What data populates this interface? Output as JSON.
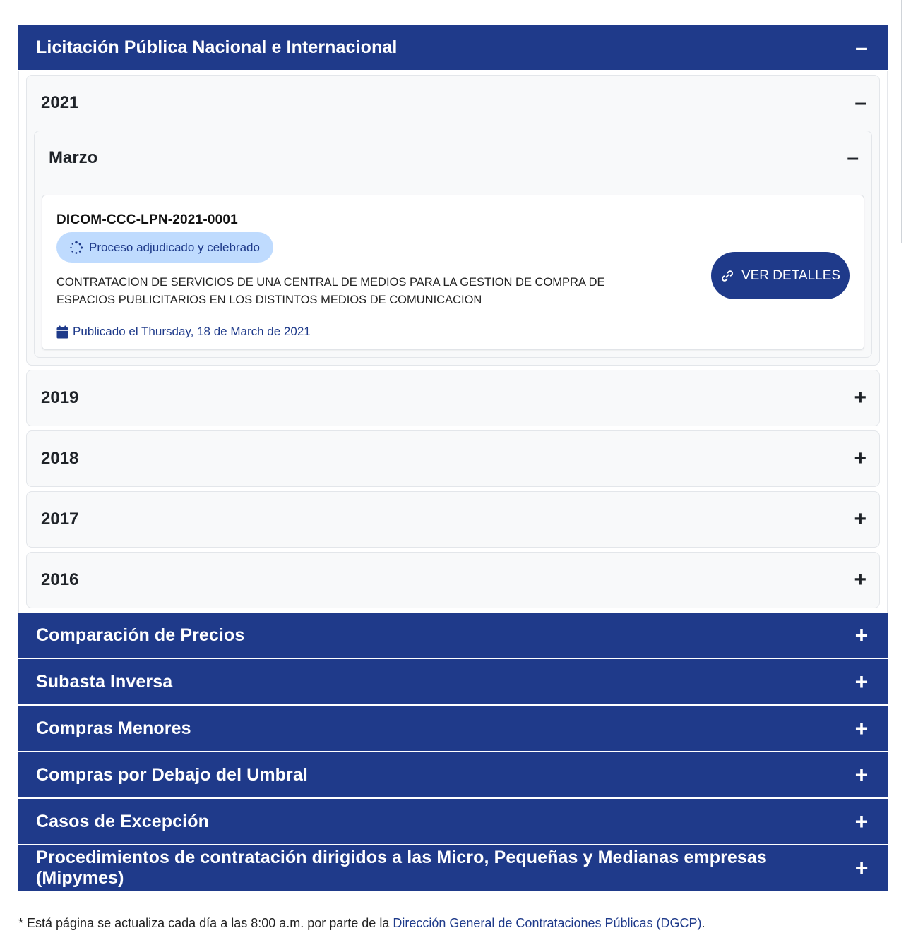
{
  "sections": [
    {
      "title": "Licitación Pública Nacional e Internacional",
      "sign": "–"
    },
    {
      "title": "Comparación de Precios",
      "sign": "+"
    },
    {
      "title": "Subasta Inversa",
      "sign": "+"
    },
    {
      "title": "Compras Menores",
      "sign": "+"
    },
    {
      "title": "Compras por Debajo del Umbral",
      "sign": "+"
    },
    {
      "title": "Casos de Excepción",
      "sign": "+"
    },
    {
      "title": "Procedimientos de contratación dirigidos a las Micro, Pequeñas y Medianas empresas (Mipymes)",
      "sign": "+"
    }
  ],
  "years": [
    {
      "label": "2021",
      "sign": "–"
    },
    {
      "label": "2019",
      "sign": "+"
    },
    {
      "label": "2018",
      "sign": "+"
    },
    {
      "label": "2017",
      "sign": "+"
    },
    {
      "label": "2016",
      "sign": "+"
    }
  ],
  "month": {
    "label": "Marzo",
    "sign": "–"
  },
  "process": {
    "code": "DICOM-CCC-LPN-2021-0001",
    "status": "Proceso adjudicado y celebrado",
    "description": "CONTRATACION DE SERVICIOS DE UNA CENTRAL DE MEDIOS PARA LA GESTION DE COMPRA DE ESPACIOS PUBLICITARIOS EN LOS DISTINTOS MEDIOS DE COMUNICACION",
    "published": "Publicado el Thursday, 18 de March de 2021",
    "button": "VER DETALLES"
  },
  "footer": {
    "text": "* Está página se actualiza cada día a las 8:00 a.m. por parte de la ",
    "link": "Dirección General de Contrataciones Públicas (DGCP)",
    "end": "."
  },
  "colors": {
    "primary": "#1f3a8a",
    "badge": "#bfdbfe"
  },
  "icons": [
    "minus-icon",
    "plus-icon",
    "spinner-icon",
    "link-icon",
    "calendar-icon"
  ]
}
